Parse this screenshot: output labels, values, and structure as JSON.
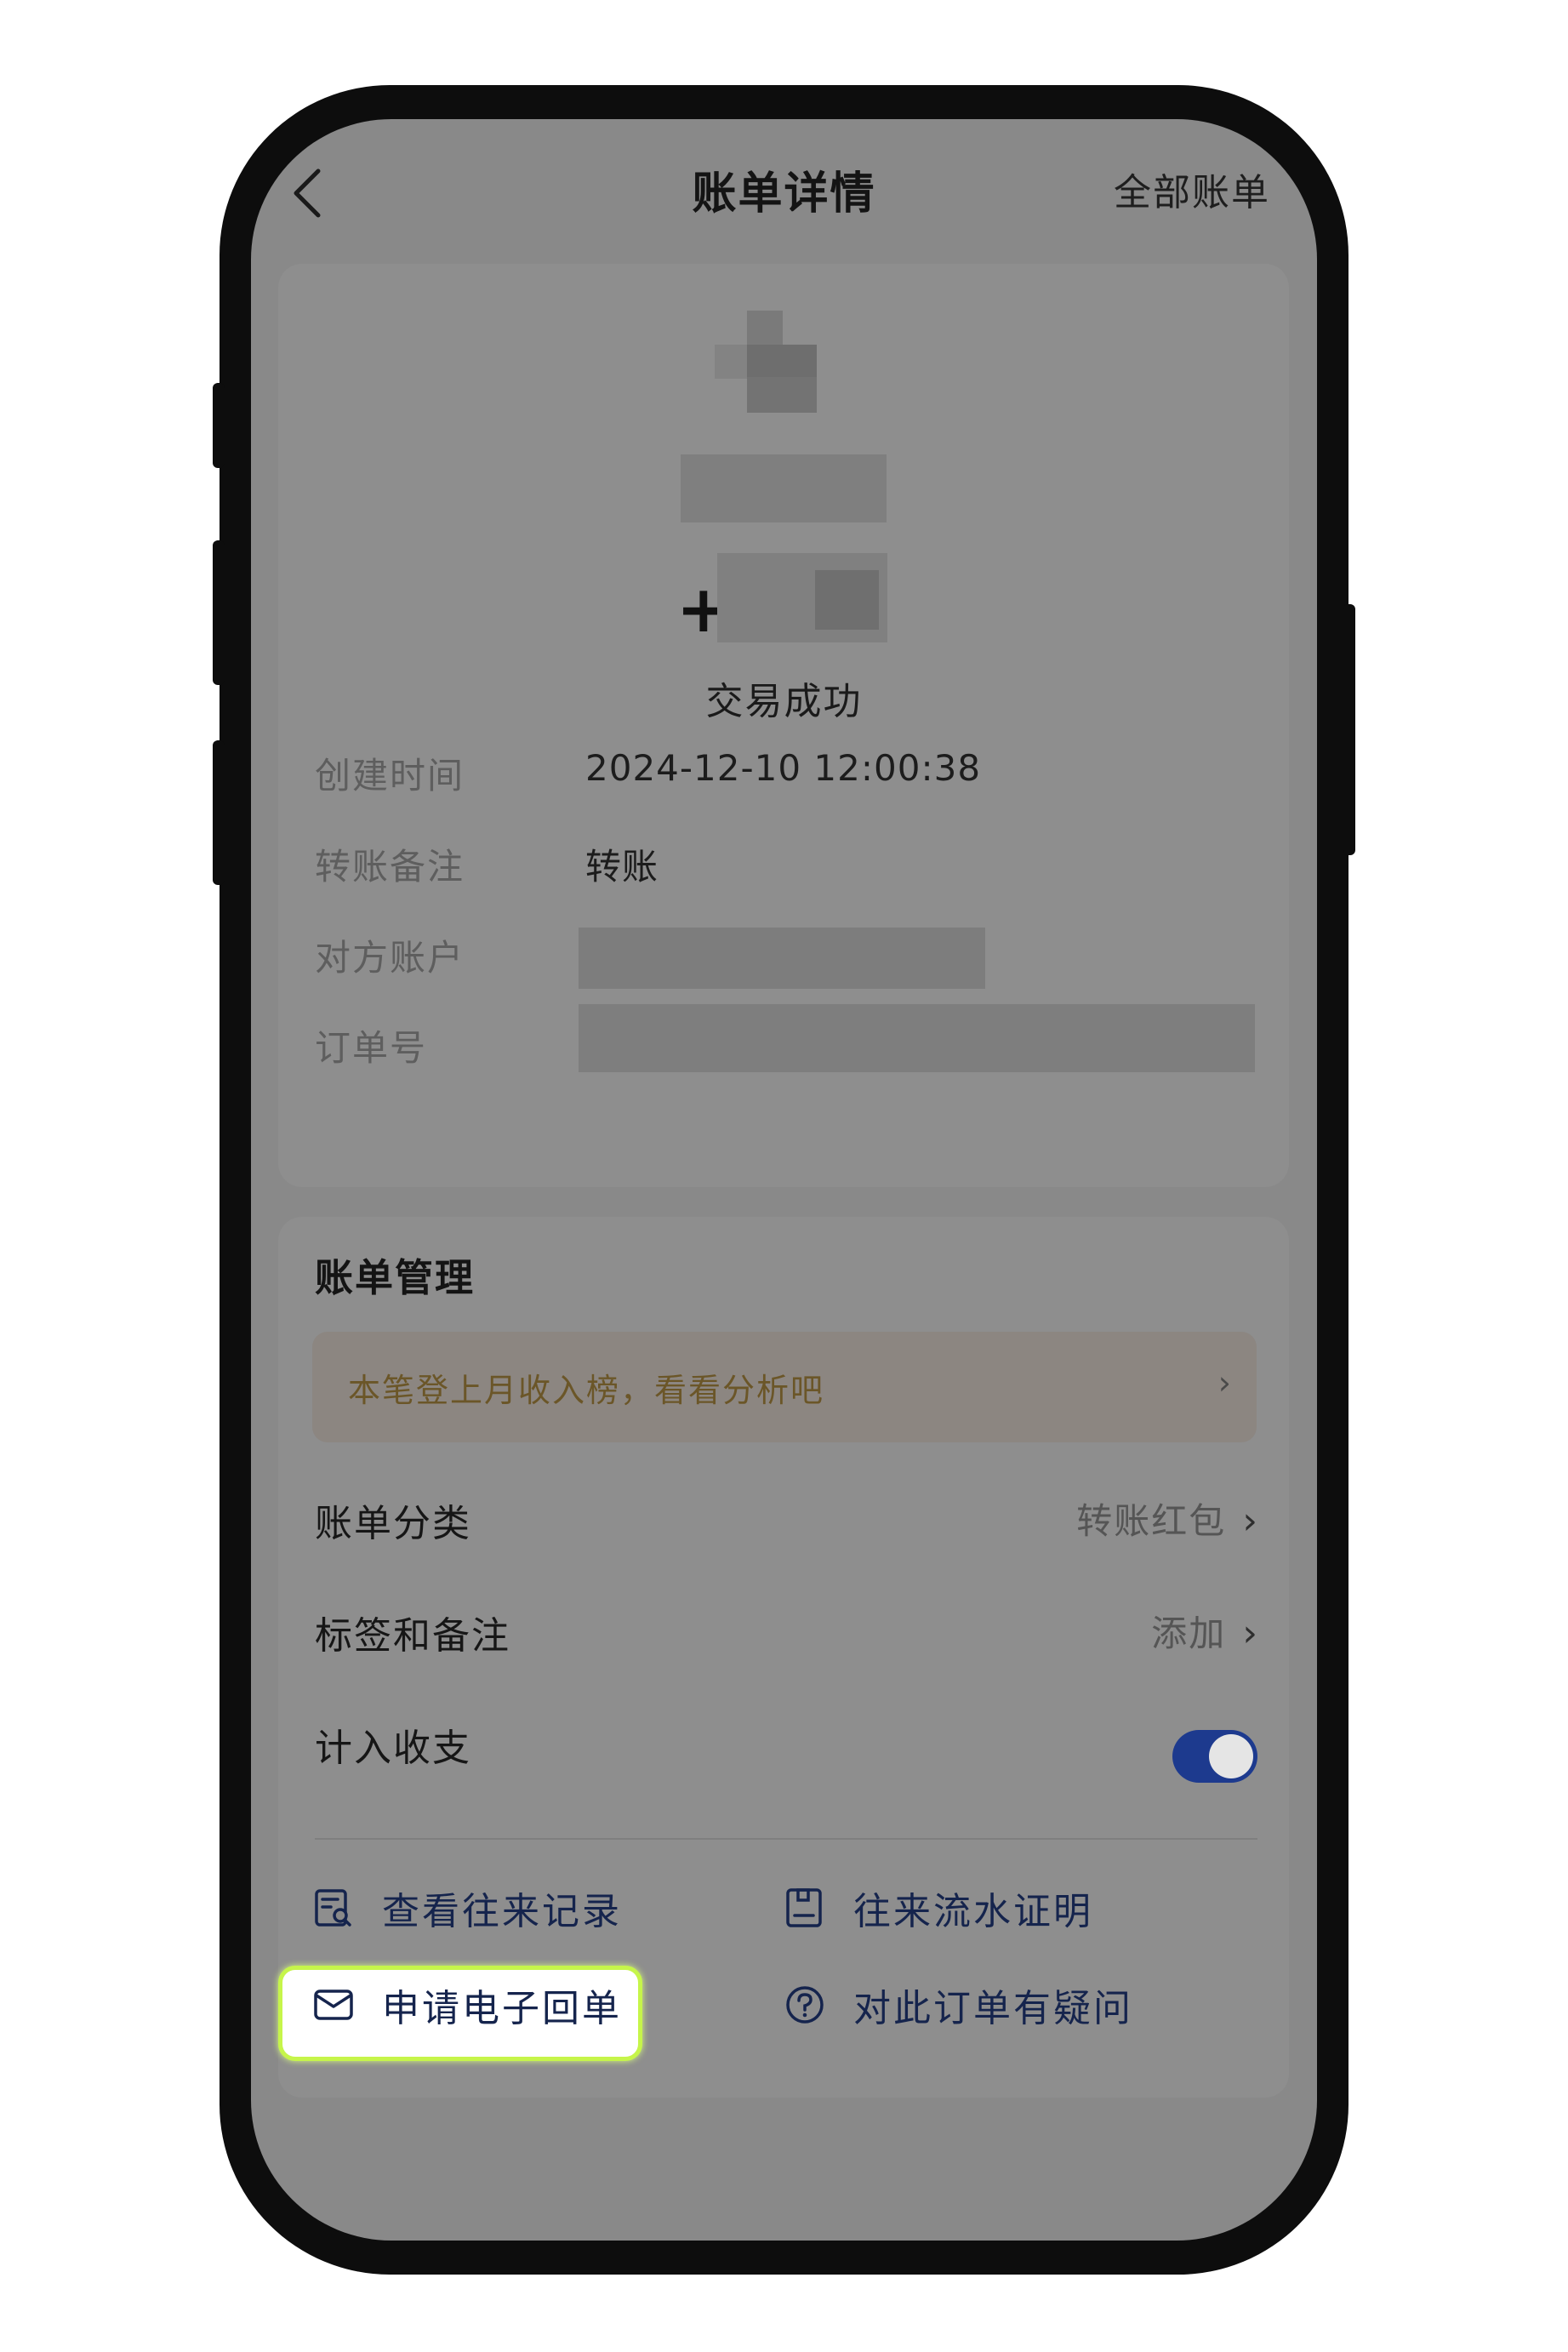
{
  "nav": {
    "title": "账单详情",
    "right_action": "全部账单"
  },
  "transaction": {
    "amount_sign": "+",
    "status": "交易成功"
  },
  "details": [
    {
      "label": "创建时间",
      "value": "2024-12-10 12:00:38"
    },
    {
      "label": "转账备注",
      "value": "转账"
    },
    {
      "label": "对方账户",
      "value": ""
    },
    {
      "label": "订单号",
      "value": ""
    }
  ],
  "management": {
    "title": "账单管理",
    "promo_text": "本笔登上月收入榜，看看分析吧",
    "category_label": "账单分类",
    "category_value": "转账红包",
    "tags_label": "标签和备注",
    "tags_value": "添加",
    "include_label": "计入收支",
    "include_enabled": true
  },
  "links": {
    "records": "查看往来记录",
    "proof": "往来流水证明",
    "receipt": "申请电子回单",
    "question": "对此订单有疑问"
  },
  "colors": {
    "toggle_on": "#1d3a8e",
    "link_text": "#15244d",
    "promo_text": "#6b5628",
    "highlight_border": "#c6f54a"
  }
}
